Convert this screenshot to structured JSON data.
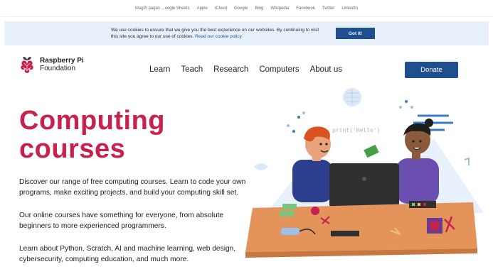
{
  "bookmarks": [
    "MagPi pages ...oogle Sheets",
    "Apple",
    "iCloud",
    "Google",
    "Bing",
    "Wikipedia",
    "Facebook",
    "Twitter",
    "LinkedIn"
  ],
  "cookie": {
    "text": "We use cookies to ensure that we give you the best experience on our websites. By continuing to visit this site you agree to our use of cookies.",
    "link": "Read our cookie policy.",
    "button": "Got it!"
  },
  "logo": {
    "line1": "Raspberry Pi",
    "line2": "Foundation"
  },
  "nav": {
    "items": [
      "Learn",
      "Teach",
      "Research",
      "Computers",
      "About us"
    ],
    "donate": "Donate"
  },
  "hero": {
    "title_line1": "Computing",
    "title_line2": "courses",
    "p1": "Discover our range of free computing courses. Learn to code your own programs, make exciting projects, and build your computing skill set.",
    "p2": "Our online courses have something for everyone, from absolute beginners to more experienced programmers.",
    "p3": "Learn about Python, Scratch, AI and machine learning, web design, cybersecurity, computing education, and much more.",
    "speech": "print('Hello')"
  },
  "colors": {
    "accent": "#c7214d",
    "brand": "#1e4f8f",
    "cookie_bg": "#e8f1fb",
    "table": "#e4935a"
  }
}
